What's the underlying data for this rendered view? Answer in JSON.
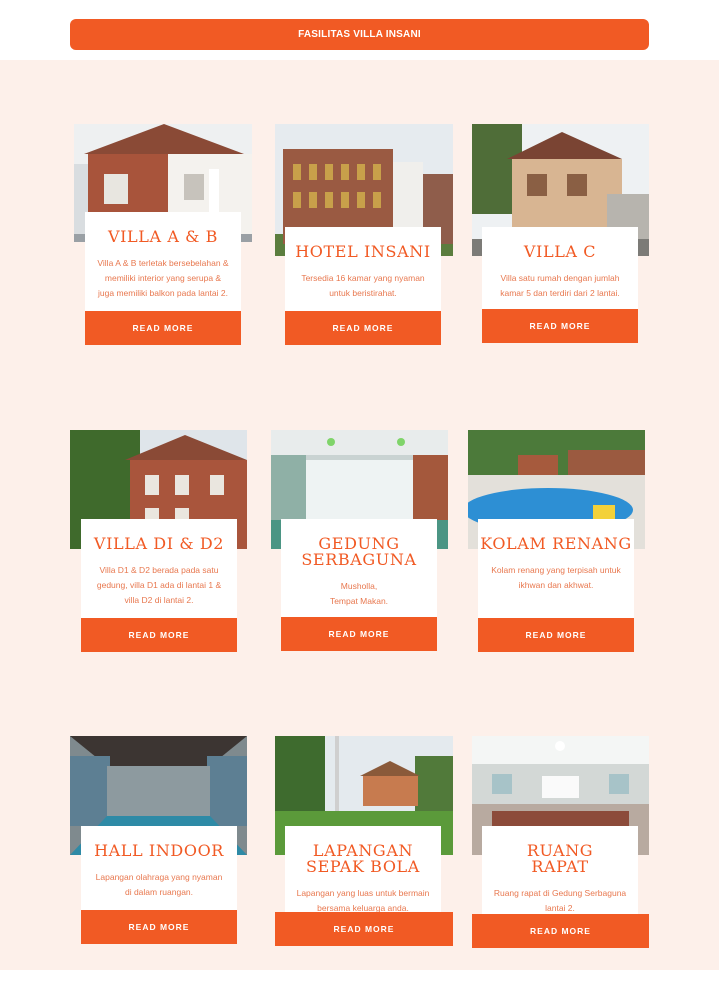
{
  "header": {
    "title": "FASILITAS VILLA INSANI"
  },
  "cards": [
    {
      "title": "VILLA A & B",
      "desc": "Villa A & B terletak bersebelahan &\nmemiliki interior yang serupa &\njuga memiliki balkon pada lantai 2.",
      "button": "READ MORE",
      "image": "villa-a-b-photo"
    },
    {
      "title": "HOTEL INSANI",
      "desc": "Tersedia 16 kamar yang nyaman\nuntuk beristirahat.",
      "button": "READ MORE",
      "image": "hotel-insani-photo"
    },
    {
      "title": "VILLA C",
      "desc": "Villa satu rumah dengan jumlah\nkamar 5 dan terdiri dari 2 lantai.",
      "button": "READ MORE",
      "image": "villa-c-photo"
    },
    {
      "title": "VILLA DI & D2",
      "desc": "Villa D1 & D2 berada pada satu\ngedung, villa D1 ada di lantai 1 &\nvilla D2 di lantai 2.",
      "button": "READ MORE",
      "image": "villa-d-photo"
    },
    {
      "title": "GEDUNG\nSERBAGUNA",
      "desc": "Musholla,\nTempat Makan.",
      "button": "READ MORE",
      "image": "gedung-serbaguna-photo"
    },
    {
      "title": "KOLAM RENANG",
      "desc": "Kolam renang yang terpisah untuk\nikhwan dan akhwat.",
      "button": "READ MORE",
      "image": "kolam-renang-photo"
    },
    {
      "title": "HALL INDOOR",
      "desc": "Lapangan olahraga yang nyaman\ndi dalam ruangan.",
      "button": "READ MORE",
      "image": "hall-indoor-photo"
    },
    {
      "title": "LAPANGAN\nSEPAK BOLA",
      "desc": "Lapangan yang luas untuk bermain\nbersama keluarga anda.",
      "button": "READ MORE",
      "image": "lapangan-photo"
    },
    {
      "title": "RUANG\nRAPAT",
      "desc": "Ruang rapat di Gedung Serbaguna\nlantai 2.",
      "button": "READ MORE",
      "image": "ruang-rapat-photo"
    }
  ],
  "colors": {
    "accent": "#f15a24",
    "background": "#fdf0ea",
    "text": "#e8784f"
  }
}
